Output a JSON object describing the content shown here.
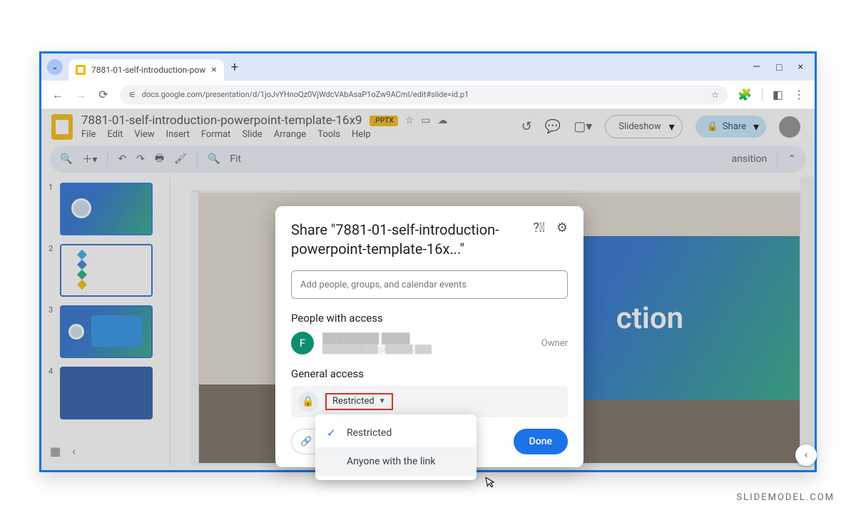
{
  "browser": {
    "tab_title": "7881-01-self-introduction-pow",
    "url": "docs.google.com/presentation/d/1joJvYHnoQz0VjWdcVAbAsaP1oZw9ACmI/edit#slide=id.p1"
  },
  "doc": {
    "title": "7881-01-self-introduction-powerpoint-template-16x9",
    "badge": ".PPTX",
    "menus": [
      "File",
      "Edit",
      "View",
      "Insert",
      "Format",
      "Slide",
      "Arrange",
      "Tools",
      "Help"
    ],
    "slideshow": "Slideshow",
    "share": "Share",
    "fit": "Fit",
    "transition": "ansition",
    "slide_text": "ction"
  },
  "thumbs": {
    "nums": [
      "1",
      "2",
      "3",
      "4"
    ]
  },
  "dialog": {
    "title": "Share \"7881-01-self-introduction-powerpoint-template-16x...\"",
    "placeholder": "Add people, groups, and calendar events",
    "people_label": "People with access",
    "owner": "Owner",
    "avatar_initial": "F",
    "general_label": "General access",
    "restricted": "Restricted",
    "copy": "",
    "done": "Done",
    "options": {
      "restricted": "Restricted",
      "anyone": "Anyone with the link"
    }
  },
  "watermark": "SLIDEMODEL.COM"
}
